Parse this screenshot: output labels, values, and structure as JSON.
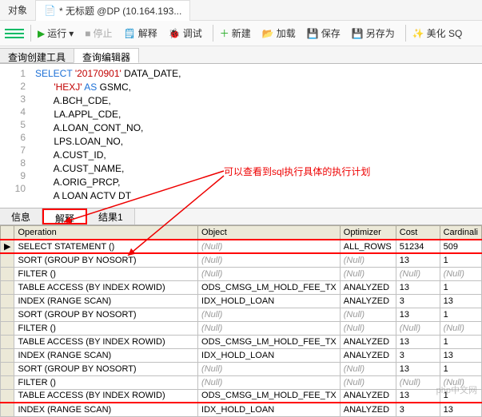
{
  "topbar": {
    "objects_tab": "对象",
    "doc_icon": "doc",
    "title": "* 无标题 @DP (10.164.193..."
  },
  "toolbar": {
    "run": "运行",
    "stop": "停止",
    "explain": "解释",
    "debug": "调试",
    "new": "新建",
    "load": "加载",
    "save": "保存",
    "saveas": "另存为",
    "beautify": "美化 SQ"
  },
  "query_tabs": {
    "builder": "查询创建工具",
    "editor": "查询编辑器"
  },
  "code": {
    "lines": [
      "1",
      "2",
      "3",
      "4",
      "5",
      "6",
      "7",
      "8",
      "9",
      "10"
    ],
    "l1a": "SELECT ",
    "l1s": "'20170901'",
    "l1b": " DATA_DATE,",
    "l2a": "       ",
    "l2s": "'HEXJ'",
    "l2b": " ",
    "l2k": "AS",
    "l2c": " GSMC,",
    "l3": "       A.BCH_CDE,",
    "l4": "       LA.APPL_CDE,",
    "l5": "       A.LOAN_CONT_NO,",
    "l6": "       LPS.LOAN_NO,",
    "l7": "       A.CUST_ID,",
    "l8": "       A.CUST_NAME,",
    "l9": "       A.ORIG_PRCP,",
    "l10": "       A LOAN ACTV DT"
  },
  "annotation": "可以查看到sql执行具体的执行计划",
  "result_tabs": {
    "info": "信息",
    "explain": "解释",
    "result1": "结果1"
  },
  "grid": {
    "headers": [
      "Operation",
      "Object",
      "Optimizer",
      "Cost",
      "Cardinali"
    ],
    "rows": [
      {
        "op": "SELECT STATEMENT ()",
        "obj": null,
        "opt": "ALL_ROWS",
        "cost": "51234",
        "card": "509"
      },
      {
        "op": " SORT (GROUP BY NOSORT)",
        "obj": null,
        "opt": null,
        "cost": "13",
        "card": "1"
      },
      {
        "op": "  FILTER ()",
        "obj": null,
        "opt": null,
        "cost": null,
        "card": null
      },
      {
        "op": "   TABLE ACCESS (BY INDEX ROWID)",
        "obj": "ODS_CMSG_LM_HOLD_FEE_TX",
        "opt": "ANALYZED",
        "cost": "13",
        "card": "1"
      },
      {
        "op": "    INDEX (RANGE SCAN)",
        "obj": "IDX_HOLD_LOAN",
        "opt": "ANALYZED",
        "cost": "3",
        "card": "13"
      },
      {
        "op": " SORT (GROUP BY NOSORT)",
        "obj": null,
        "opt": null,
        "cost": "13",
        "card": "1"
      },
      {
        "op": "  FILTER ()",
        "obj": null,
        "opt": null,
        "cost": null,
        "card": null
      },
      {
        "op": "   TABLE ACCESS (BY INDEX ROWID)",
        "obj": "ODS_CMSG_LM_HOLD_FEE_TX",
        "opt": "ANALYZED",
        "cost": "13",
        "card": "1"
      },
      {
        "op": "    INDEX (RANGE SCAN)",
        "obj": "IDX_HOLD_LOAN",
        "opt": "ANALYZED",
        "cost": "3",
        "card": "13"
      },
      {
        "op": " SORT (GROUP BY NOSORT)",
        "obj": null,
        "opt": null,
        "cost": "13",
        "card": "1"
      },
      {
        "op": "  FILTER ()",
        "obj": null,
        "opt": null,
        "cost": null,
        "card": null
      },
      {
        "op": "   TABLE ACCESS (BY INDEX ROWID)",
        "obj": "ODS_CMSG_LM_HOLD_FEE_TX",
        "opt": "ANALYZED",
        "cost": "13",
        "card": "1"
      },
      {
        "op": "    INDEX (RANGE SCAN)",
        "obj": "IDX_HOLD_LOAN",
        "opt": "ANALYZED",
        "cost": "3",
        "card": "13"
      }
    ]
  },
  "watermark": "php中文网"
}
